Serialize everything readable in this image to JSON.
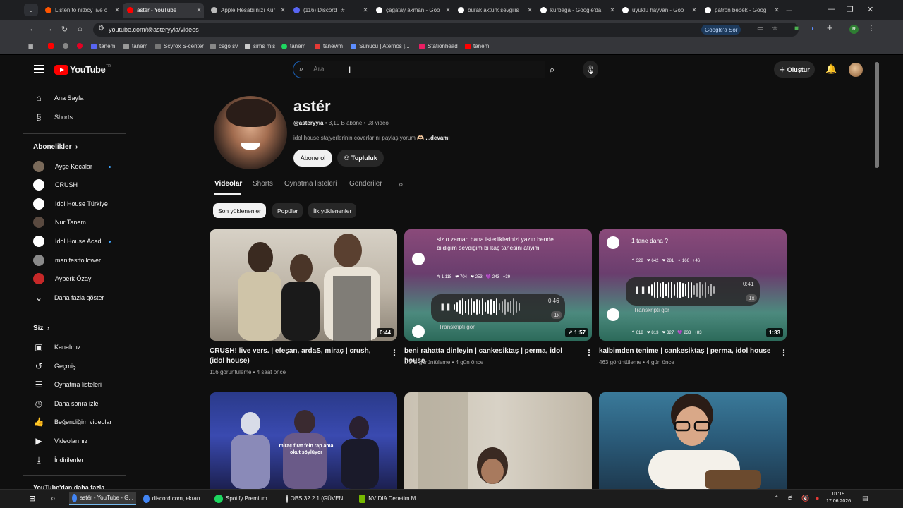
{
  "browser": {
    "tabs": [
      {
        "title": "Listen to nitbcy live c",
        "favicon_color": "#ff5500"
      },
      {
        "title": "astér - YouTube",
        "favicon_color": "#ff0000"
      },
      {
        "title": "Apple Hesabı'nızı Kur",
        "favicon_color": "#bbbbbb"
      },
      {
        "title": "(116) Discord | #",
        "favicon_color": "#5865f2"
      },
      {
        "title": "çağatay akman - Goo",
        "favicon_color": "#ffffff"
      },
      {
        "title": "burak akturk sevgilis",
        "favicon_color": "#ffffff"
      },
      {
        "title": "kurbağa - Google'da",
        "favicon_color": "#ffffff"
      },
      {
        "title": "uyuklu hayvan - Goo",
        "favicon_color": "#ffffff"
      },
      {
        "title": "patron bebek - Goog",
        "favicon_color": "#ffffff"
      }
    ],
    "url": "youtube.com/@asteryyia/videos",
    "google_sor": "Google'a Sor",
    "bookmarks": [
      {
        "label": "",
        "color": "#ff0000"
      },
      {
        "label": "",
        "color": "#888888"
      },
      {
        "label": "",
        "color": "#e60023"
      },
      {
        "label": "tanem",
        "color": "#5865f2"
      },
      {
        "label": "tanem",
        "color": "#999999"
      },
      {
        "label": "Scyrox S-center",
        "color": "#777777"
      },
      {
        "label": "csgo sv",
        "color": "#888888"
      },
      {
        "label": "sims mis",
        "color": "#333333"
      },
      {
        "label": "tanem",
        "color": "#1ed760"
      },
      {
        "label": "tanewm",
        "color": "#e53935"
      },
      {
        "label": "Sunucu | Aternos |...",
        "color": "#5c8dff"
      },
      {
        "label": "Stationhead",
        "color": "#e91e63"
      },
      {
        "label": "tanem",
        "color": "#ff0000"
      }
    ]
  },
  "youtube": {
    "logo_text": "YouTube",
    "logo_region": "TR",
    "search_placeholder": "Ara",
    "create_label": "Oluştur",
    "sidebar": {
      "main": [
        {
          "label": "Ana Sayfa",
          "icon": "home-icon",
          "glyph": "⌂"
        },
        {
          "label": "Shorts",
          "icon": "shorts-icon",
          "glyph": "§"
        }
      ],
      "subscriptions_title": "Abonelikler",
      "subscriptions": [
        {
          "label": "Ayşe Kocalar",
          "color": "#7a6a5a",
          "live": true
        },
        {
          "label": "CRUSH",
          "color": "#ffffff",
          "live": false
        },
        {
          "label": "Idol House Türkiye",
          "color": "#ffffff",
          "live": false
        },
        {
          "label": "Nur Tanem",
          "color": "#5a4a40",
          "live": false
        },
        {
          "label": "Idol House Acad...",
          "color": "#ffffff",
          "live": true
        },
        {
          "label": "manifestfollower",
          "color": "#8a8a8a",
          "live": false
        },
        {
          "label": "Ayberk Özay",
          "color": "#c62828",
          "live": false
        }
      ],
      "show_more": "Daha fazla göster",
      "you_title": "Siz",
      "you": [
        {
          "label": "Kanalınız",
          "icon": "channel-icon",
          "glyph": "▣"
        },
        {
          "label": "Geçmiş",
          "icon": "history-icon",
          "glyph": "↺"
        },
        {
          "label": "Oynatma listeleri",
          "icon": "playlists-icon",
          "glyph": "☰"
        },
        {
          "label": "Daha sonra izle",
          "icon": "watch-later-icon",
          "glyph": "◷"
        },
        {
          "label": "Beğendiğim videolar",
          "icon": "like-icon",
          "glyph": "👍"
        },
        {
          "label": "Videolarınız",
          "icon": "your-videos-icon",
          "glyph": "▶"
        },
        {
          "label": "İndirilenler",
          "icon": "download-icon",
          "glyph": "⤓"
        }
      ],
      "bottom_title": "YouTube'dan daha fazla"
    },
    "channel": {
      "name": "astér",
      "handle": "@asteryyia",
      "meta": " • 3,19 B abone • 98 video",
      "description": "idol house stajyerlerinin coverlarını paylaşıyorum 🫶🏻 ",
      "more": "...devamı",
      "subscribe_label": "Abone ol",
      "community_label": "Topluluk",
      "tabs": [
        "Videolar",
        "Shorts",
        "Oynatma listeleri",
        "Gönderiler"
      ],
      "chips": [
        "Son yüklenenler",
        "Popüler",
        "İlk yüklenenler"
      ]
    },
    "videos": [
      {
        "title": "CRUSH! live vers. | efeşan, ardaS, miraç | crush, (idol house)",
        "meta": "116 görüntüleme • 4 saat önce",
        "duration": "0:44"
      },
      {
        "title": "beni rahatta dinleyin | cankesiktaş | perma, idol house",
        "meta": "1,9 B görüntüleme • 4 gün önce",
        "duration": "1:57",
        "bubble": "siz o zaman bana istediklerinizi yazın bende bildiğim sevdiğim bi kaç tanesini atiyim",
        "timer": "0:46",
        "speed": "1x",
        "transcript": "Transkripti gör",
        "stats": [
          "↰ 1.118",
          "❤ 704",
          "❤ 253",
          "💜 243",
          "+39"
        ]
      },
      {
        "title": "kalbimden tenime | cankesiktaş | perma, idol house",
        "meta": "463 görüntüleme • 4 gün önce",
        "duration": "1:33",
        "bubble": "1 tane daha ?",
        "timer": "0:41",
        "speed": "1x",
        "transcript": "Transkripti gör",
        "stats_top": [
          "↰ 328",
          "❤ 642",
          "❤ 281",
          "✦ 166",
          "+46"
        ],
        "stats": [
          "↰ 618",
          "❤ 813",
          "❤ 327",
          "💜 233",
          "+83"
        ]
      },
      {
        "overlay": "miraç fırat fein rap ama okut söylüyor"
      },
      {},
      {}
    ]
  },
  "taskbar": {
    "items": [
      {
        "label": "astér - YouTube - G...",
        "color": "#4285f4"
      },
      {
        "label": "discord.com, ekran...",
        "color": "#4285f4"
      },
      {
        "label": "Spotify Premium",
        "color": "#1ed760"
      },
      {
        "label": "OBS 32.2.1 (GÜVEN...",
        "color": "#dddddd"
      },
      {
        "label": "NVIDIA Denetim M...",
        "color": "#76b900"
      }
    ],
    "time": "01:19",
    "date": "17.06.2026"
  }
}
